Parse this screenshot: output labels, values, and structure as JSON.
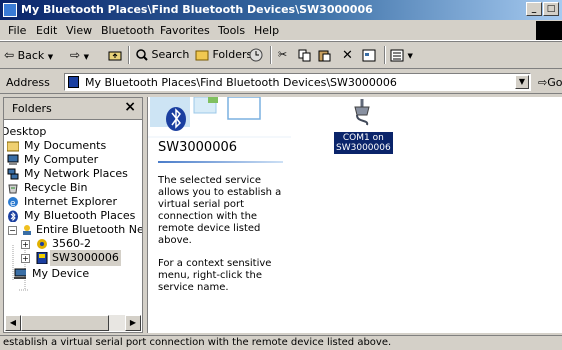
{
  "window": {
    "title": "My Bluetooth Places\\Find Bluetooth Devices\\SW3000006"
  },
  "menu": [
    "File",
    "Edit",
    "View",
    "Bluetooth",
    "Favorites",
    "Tools",
    "Help"
  ],
  "toolbar": {
    "back": "Back",
    "search": "Search",
    "folders": "Folders"
  },
  "address": {
    "label": "Address",
    "value": "My Bluetooth Places\\Find Bluetooth Devices\\SW3000006",
    "go": "Go"
  },
  "folders_pane": {
    "title": "Folders",
    "close": "×",
    "items": [
      {
        "label": "Desktop"
      },
      {
        "label": "My Documents"
      },
      {
        "label": "My Computer"
      },
      {
        "label": "My Network Places"
      },
      {
        "label": "Recycle Bin"
      },
      {
        "label": "Internet Explorer"
      },
      {
        "label": "My Bluetooth Places"
      },
      {
        "label": "Entire Bluetooth Neig"
      },
      {
        "label": "3560-2"
      },
      {
        "label": "SW3000006"
      },
      {
        "label": "My Device"
      }
    ]
  },
  "content": {
    "heading": "SW3000006",
    "desc1": "The selected service allows you to establish a virtual serial port connection with the remote device listed above.",
    "desc2": "For a context sensitive menu, right-click the service name.",
    "service": {
      "line1": "COM1 on",
      "line2": "SW3000006"
    }
  },
  "status": {
    "text": "establish a virtual serial port connection with the remote device listed above."
  },
  "colors": {
    "title_bar": "#0a246a",
    "selection": "#0a246a",
    "chrome": "#d4d0c8"
  }
}
